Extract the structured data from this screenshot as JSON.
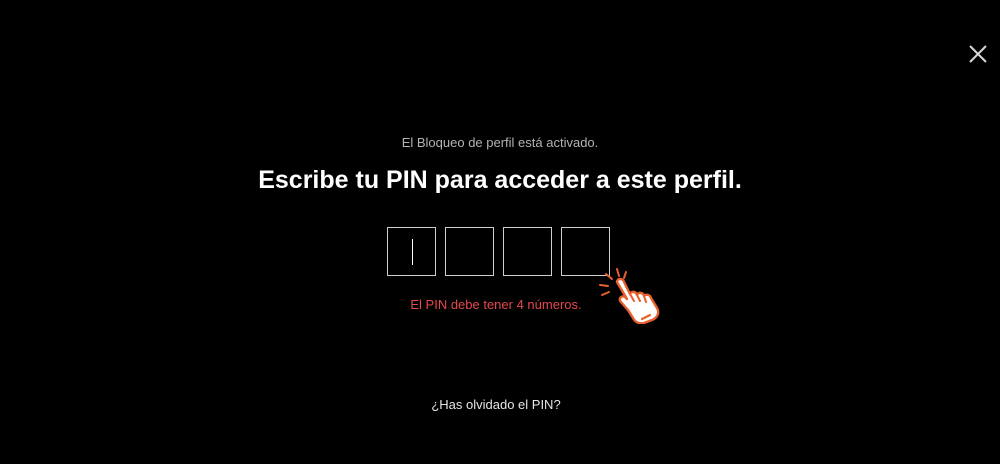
{
  "status": {
    "text": "El Bloqueo de perfil está activado."
  },
  "prompt": {
    "title": "Escribe tu PIN para acceder a este perfil."
  },
  "pin": {
    "digits": 4,
    "values": [
      "",
      "",
      "",
      ""
    ],
    "focused_index": 0
  },
  "error": {
    "text": "El PIN debe tener 4 números."
  },
  "links": {
    "forgot_pin": "¿Has olvidado el PIN?"
  },
  "icons": {
    "close": "close-icon",
    "cursor": "pointing-hand-icon"
  },
  "colors": {
    "background": "#000000",
    "title": "#ffffff",
    "status": "#b3b3b3",
    "error": "#e5484d",
    "pin_border": "#cfcfcf",
    "cursor_accent": "#e8602c"
  }
}
